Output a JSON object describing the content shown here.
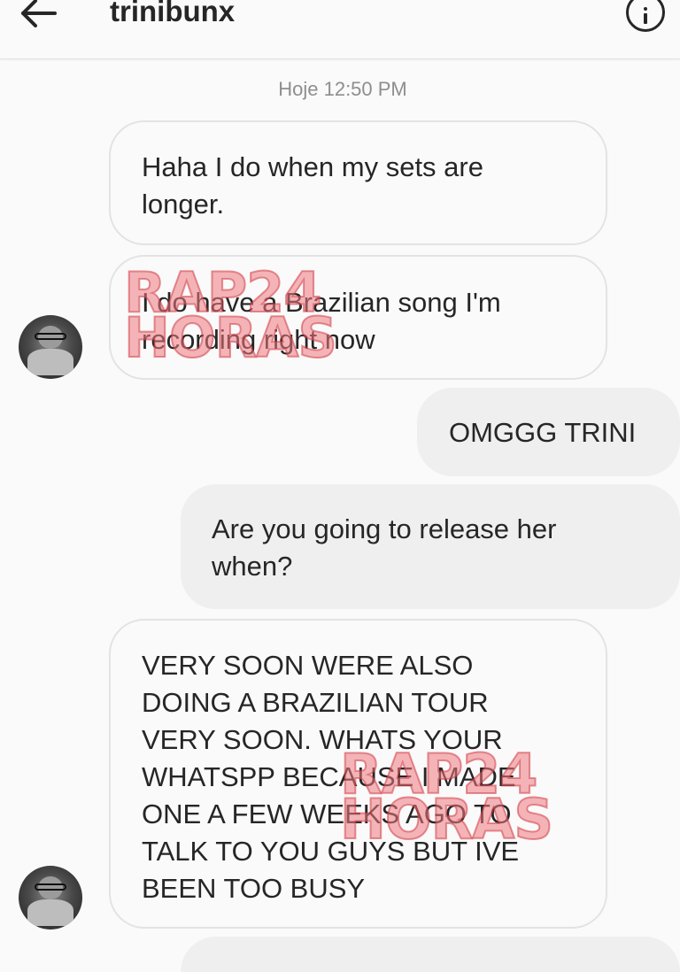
{
  "header": {
    "username": "trinibunx",
    "back_icon": "arrow-left-icon",
    "info_icon": "info-icon"
  },
  "timestamp": "Hoje 12:50 PM",
  "messages": [
    {
      "direction": "in",
      "lines": [
        "Haha I do when my sets are",
        "longer."
      ]
    },
    {
      "direction": "in",
      "lines": [
        "I do have a Brazilian song I'm",
        "recording right now"
      ]
    },
    {
      "direction": "out",
      "lines": [
        "OMGGG TRINI"
      ]
    },
    {
      "direction": "out",
      "lines": [
        "Are you going to release her",
        "when?"
      ]
    },
    {
      "direction": "in",
      "lines": [
        "VERY SOON WERE ALSO",
        "DOING A BRAZILIAN TOUR",
        "VERY SOON. WHATS YOUR",
        "WHATSPP BECAUSE I MADE",
        "ONE A FEW WEEKS AGO TO",
        "TALK TO YOU GUYS BUT IVE",
        "BEEN TOO BUSY"
      ]
    }
  ],
  "watermark": {
    "line1": "RAP24",
    "line2": "HORAS"
  },
  "colors": {
    "background": "#fafafa",
    "outgoing_bubble": "#efefef",
    "incoming_border": "#e3e3e3",
    "timestamp": "#8e8e8e",
    "watermark": "#ec7880"
  }
}
